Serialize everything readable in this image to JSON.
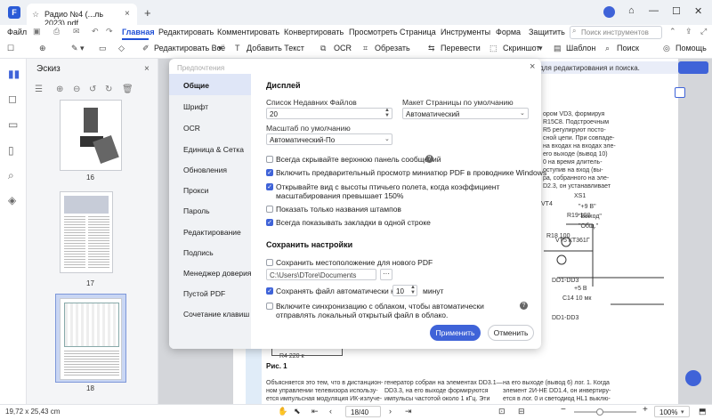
{
  "window": {
    "tab_title": "Радио №4 (...ль 2023).pdf",
    "new_tab": "+",
    "close": "×",
    "minimize": "—",
    "maximize": "☐",
    "close_window": "✕"
  },
  "menu": {
    "file": "Файл",
    "items": [
      "Главная",
      "Редактировать",
      "Комментировать",
      "Конвертировать",
      "Просмотреть",
      "Страница",
      "Инструменты",
      "Форма",
      "Защитить"
    ],
    "search_placeholder": "Поиск инструментов"
  },
  "toolbar": {
    "edit_all": "Редактировать Всё",
    "add_text": "Добавить Текст",
    "ocr": "OCR",
    "crop": "Обрезать",
    "translate": "Перевести",
    "screenshot": "Скриншот",
    "template": "Шаблон",
    "search": "Поиск",
    "help": "Помощь"
  },
  "thumbnails": {
    "title": "Эскиз",
    "pages": [
      "16",
      "17",
      "18"
    ]
  },
  "banner": {
    "text": "ам для редактирования и поиска."
  },
  "document": {
    "fig_label": "Рис. 1",
    "page_text_1": "Объясняется это тем, что в дистанцион-",
    "page_text_2": "ном управлении телевизора использу-",
    "page_text_3": "ется импульсная модуляция ИК-излуче-",
    "page_text_4": "генератор собран на элементах DD3.1—",
    "page_text_5": "DD3.3, на его выходе формируются",
    "page_text_6": "импульсы частотой около 1 кГц. Эти",
    "page_text_7": "на его выходе (вывод 6) лог. 1. Когда",
    "page_text_8": "элемент 2И-НЕ DD1.4, он инвертиру-",
    "page_text_9": "ется в лог. 0 и светодиод HL1 выклю-",
    "right_col": [
      "ором VD3, формируя",
      "R15C8. Подстроечным",
      "R5 регулируют посто-",
      "сной цепи. При совпаде-",
      "на входах на входах эле-",
      "его выходе (вывод 10)",
      "0 на время длитель-",
      "оступив на вход (вы-",
      "ра, собранного на эле-",
      "D2.3, он устанавливает"
    ],
    "circuit_labels": [
      "XS1",
      "\"+9 В\"",
      "\"Выход\"",
      "\"Общ.\"",
      "VT4",
      "R19 100",
      "R18 100",
      "VT5 КТ361Г",
      "DD1-DD3",
      "+5 В",
      "C14 10 мк",
      "DD1-DD3",
      "R4 220 к"
    ]
  },
  "status": {
    "dimensions": "19,72 x 25,43 cm",
    "page": "18/40",
    "zoom": "100%"
  },
  "dialog": {
    "title": "Предпочтения",
    "nav": [
      "Общие",
      "Шрифт",
      "OCR",
      "Единица & Сетка",
      "Обновления",
      "Прокси",
      "Пароль",
      "Редактирование",
      "Подпись",
      "Менеджер доверия",
      "Пустой PDF",
      "Сочетание клавиш"
    ],
    "display_title": "Дисплей",
    "recent_label": "Список Недавних Файлов",
    "recent_value": "20",
    "layout_label": "Макет Страницы по умолчанию",
    "layout_value": "Автоматический",
    "zoom_label": "Масштаб по умолчанию",
    "zoom_value": "Автоматический-По",
    "checks": [
      {
        "label": "Всегда скрывайте верхнюю панель сообщений",
        "checked": false
      },
      {
        "label": "Включить предварительный просмотр миниатюр PDF в проводнике Windows",
        "checked": true
      },
      {
        "label": "Открывайте вид с высоты птичьего полета, когда коэффициент масштабирования превышает 150%",
        "checked": true
      },
      {
        "label": "Показать только названия штампов",
        "checked": false
      },
      {
        "label": "Всегда показывать закладки в одной строке",
        "checked": true
      }
    ],
    "save_title": "Сохранить настройки",
    "save_location_label": "Сохранить местоположение для нового PDF",
    "save_path": "C:\\Users\\DTore\\Documents",
    "browse": "···",
    "autosave_label": "Сохранять файл автоматически каждые",
    "autosave_value": "10",
    "autosave_unit": "минут",
    "cloud_sync_label": "Включите синхронизацию с облаком, чтобы автоматически отправлять локальный открытый файл в облако.",
    "apply": "Применить",
    "cancel": "Отменить"
  }
}
